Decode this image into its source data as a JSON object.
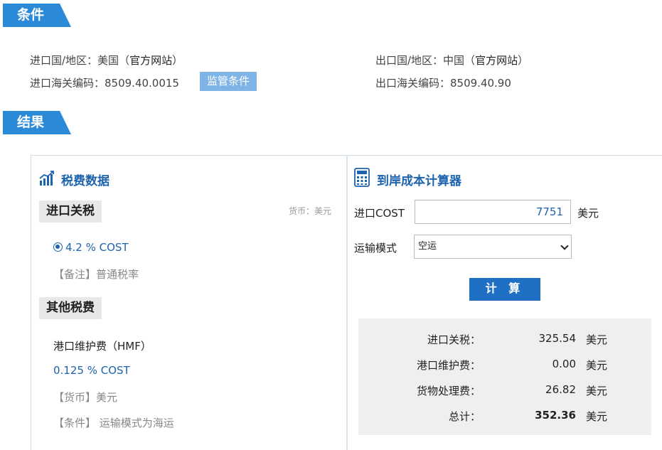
{
  "sections": {
    "conditions": "条件",
    "results": "结果"
  },
  "conditions": {
    "import_country_label": "进口国/地区：美国（",
    "import_country_link": "官方网站",
    "import_country_end": "）",
    "export_country_label": "出口国/地区：中国（",
    "export_country_link": "官方网站",
    "export_country_end": "）",
    "import_hs": "进口海关编码：8509.40.0015",
    "regulatory_badge": "监管条件",
    "export_hs": "出口海关编码：8509.40.90"
  },
  "tax_panel": {
    "title": "税费数据",
    "import_duty_heading": "进口关税",
    "currency_note": "货币：美元",
    "rate_option": "4.2 % COST",
    "remark": "【备注】普通税率",
    "other_fees_heading": "其他税费",
    "hmf_name": "港口维护费（HMF）",
    "hmf_rate": "0.125 % COST",
    "hmf_currency": "【货币】美元",
    "hmf_condition": "【条件】 运输模式为海运"
  },
  "calculator": {
    "title": "到岸成本计算器",
    "cost_label": "进口COST",
    "cost_value": "7751",
    "cost_unit": "美元",
    "transport_label": "运输模式",
    "transport_selected": "空运",
    "calculate_button": "计 算",
    "results": {
      "import_duty_label": "进口关税：",
      "import_duty_value": "325.54",
      "hmf_label": "港口维护费：",
      "hmf_value": "0.00",
      "handling_label": "货物处理费：",
      "handling_value": "26.82",
      "total_label": "总计：",
      "total_value": "352.36",
      "unit": "美元"
    }
  },
  "colors": {
    "accent": "#2b8ad8",
    "link_blue": "#1e63ad",
    "button": "#1f6fc4",
    "badge": "#7fb4e6"
  }
}
